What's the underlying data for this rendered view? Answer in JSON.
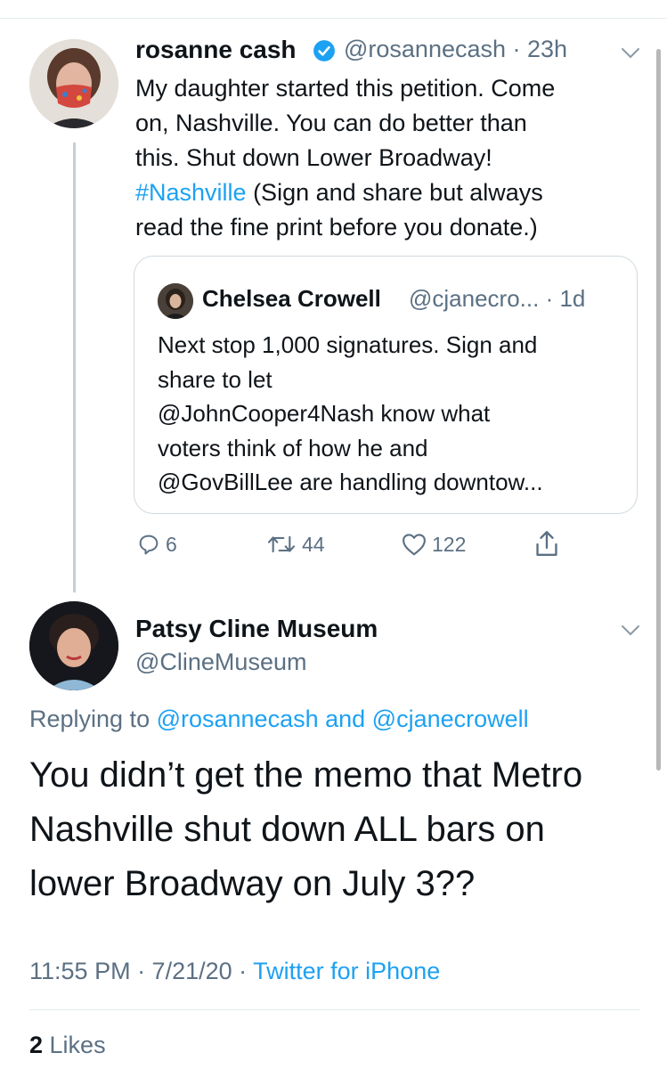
{
  "tweet": {
    "author_name": "rosanne cash",
    "handle_time": "@rosannecash · 23h",
    "lines": [
      "My daughter started this petition. Come",
      "on, Nashville. You can do better than",
      "this. Shut down Lower Broadway!"
    ],
    "hashtag": "#Nashville",
    "line4_rest": " (Sign and share but always",
    "line5": "read the fine print before you donate.)"
  },
  "quote": {
    "author_name": "Chelsea Crowell",
    "handle_time": "@cjanecro... · 1d",
    "lines": [
      "Next stop 1,000 signatures. Sign and",
      "share to let",
      "@JohnCooper4Nash know what",
      "voters think of how he and",
      "@GovBillLee are handling downtow..."
    ]
  },
  "actions": {
    "replies": "6",
    "retweets": "44",
    "likes": "122"
  },
  "reply": {
    "author_name": "Patsy Cline Museum",
    "handle": "@ClineMuseum",
    "replying_prefix": "Replying to ",
    "replying_to_1": "@rosannecash",
    "replying_and": " and ",
    "replying_to_2": "@cjanecrowell",
    "lines": [
      "You didn’t get the memo that Metro",
      "Nashville shut down ALL bars on",
      "lower Broadway on  July 3??"
    ],
    "time_date": "11:55 PM · 7/21/20 · ",
    "source": "Twitter for iPhone",
    "likes_count": "2",
    "likes_label": " Likes"
  },
  "colors": {
    "link": "#1da1f2",
    "secondary": "#5b7083",
    "text": "#0f1419"
  },
  "icons": [
    "verified-badge-icon",
    "chevron-down-icon",
    "reply-icon",
    "retweet-icon",
    "like-icon",
    "share-icon"
  ]
}
